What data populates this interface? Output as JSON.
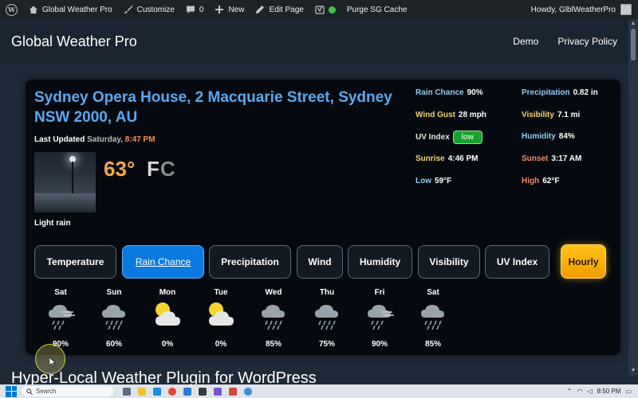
{
  "adminbar": {
    "site_name": "Global Weather Pro",
    "customize": "Customize",
    "comments": "0",
    "new": "New",
    "edit_page": "Edit Page",
    "purge": "Purge SG Cache",
    "howdy": "Howdy, GlblWeatherPro"
  },
  "header": {
    "title": "Global Weather Pro",
    "nav": [
      "Demo",
      "Privacy Policy"
    ]
  },
  "weather": {
    "location": "Sydney Opera House, 2 Macquarie Street, Sydney NSW 2000, AU",
    "last_updated_label": "Last Updated",
    "last_updated_day": "Saturday,",
    "last_updated_time": "8:47 PM",
    "temperature": "63°",
    "unit_f": "F",
    "unit_c": "C",
    "condition": "Light rain",
    "stats": {
      "rain_chance_label": "Rain Chance",
      "rain_chance": "90%",
      "precipitation_label": "Precipitation",
      "precipitation": "0.82 in",
      "wind_gust_label": "Wind Gust",
      "wind_gust": "28 mph",
      "visibility_label": "Visibility",
      "visibility": "7.1 mi",
      "uv_index_label": "UV Index",
      "uv_index": "low",
      "humidity_label": "Humidity",
      "humidity": "84%",
      "sunrise_label": "Sunrise",
      "sunrise": "4:46 PM",
      "sunset_label": "Sunset",
      "sunset": "3:17 AM",
      "low_label": "Low",
      "low": "59°F",
      "high_label": "High",
      "high": "62°F"
    },
    "colors": {
      "rain_chance": "#8ecdf5",
      "precipitation": "#8ecdf5",
      "wind_gust": "#f3d36a",
      "visibility": "#f3d36a",
      "uv_index": "#e6e6e6",
      "humidity": "#8ecdf5",
      "sunrise": "#f3d36a",
      "sunset": "#f08a6a",
      "low": "#8ecdf5",
      "high": "#f08a6a"
    },
    "tabs": [
      "Temperature",
      "Rain Chance",
      "Precipitation",
      "Wind",
      "Humidity",
      "Visibility",
      "UV Index"
    ],
    "active_tab": "Rain Chance",
    "hourly_button": "Hourly",
    "forecast": [
      {
        "day": "Sat",
        "icon": "rain-wind-icon",
        "value": "90%"
      },
      {
        "day": "Sun",
        "icon": "rain-icon",
        "value": "60%"
      },
      {
        "day": "Mon",
        "icon": "partly-sunny-icon",
        "value": "0%"
      },
      {
        "day": "Tue",
        "icon": "partly-sunny-icon",
        "value": "0%"
      },
      {
        "day": "Wed",
        "icon": "rain-icon",
        "value": "85%"
      },
      {
        "day": "Thu",
        "icon": "rain-icon",
        "value": "75%"
      },
      {
        "day": "Fri",
        "icon": "rain-wind-icon",
        "value": "90%"
      },
      {
        "day": "Sat",
        "icon": "rain-icon",
        "value": "85%"
      }
    ]
  },
  "section_heading": "Hyper-Local Weather Plugin for WordPress",
  "taskbar": {
    "search_label": "Search",
    "time": "8:50 PM"
  }
}
